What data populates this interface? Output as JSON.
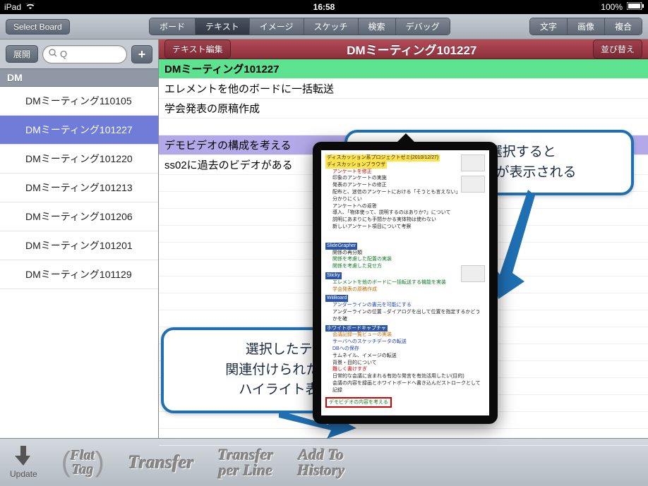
{
  "status": {
    "carrier": "iPad",
    "time": "16:58",
    "battery": "100%"
  },
  "toolbar": {
    "select_board": "Select Board",
    "segments_main": {
      "items": [
        "ボード",
        "テキスト",
        "イメージ",
        "スケッチ",
        "検索",
        "デバッグ"
      ],
      "active_index": 1
    },
    "segments_right": {
      "items": [
        "文字",
        "画像",
        "複合"
      ]
    }
  },
  "sidebar": {
    "expand": "展開",
    "search_placeholder": "Q",
    "group": "DM",
    "items": [
      "DMミーティング110105",
      "DMミーティング101227",
      "DMミーティング101220",
      "DMミーティング101213",
      "DMミーティング101206",
      "DMミーティング101201",
      "DMミーティング101129"
    ],
    "selected_index": 1
  },
  "content": {
    "edit_btn": "テキスト編集",
    "title": "DMミーティング101227",
    "sort_btn": "並び替え",
    "rows": [
      {
        "text": "DMミーティング101227",
        "style": "green"
      },
      {
        "text": "エレメントを他のボードに一括転送",
        "style": ""
      },
      {
        "text": "学会発表の原稿作成",
        "style": ""
      },
      {
        "text": "",
        "style": ""
      },
      {
        "text": "デモビデオの構成を考える",
        "style": "purple"
      },
      {
        "text": "ss02に過去のビデオがある",
        "style": ""
      }
    ]
  },
  "callouts": {
    "c1_l1": "テキストを選択すると",
    "c1_l2": "関連コンテンツが表示される",
    "c2_l1": "選択したテキストに",
    "c2_l2": "関連付けられたテキストが",
    "c2_l3": "ハイライト表示される"
  },
  "doc": {
    "hdr1": "ディスカッション系プロジェクトゼミ(2010/12/27)",
    "hdr2": "ディスカッションブラウザ",
    "red1": "アンケートを修正",
    "b_sg": "SlideGrapher",
    "sg1": "関係の再分類",
    "sg2": "関係を考慮した配置の実装",
    "sg3": "関係を考慮した見せ方",
    "b_st": "Sticky",
    "st1": "エレメントを他のボードに一括転送する機能を実装",
    "st2": "学会発表の原稿作成",
    "b_wb": "WiiBoard",
    "wb1": "アンダーラインの書元を可能にする",
    "b_wc": "ホワイトボードキャプチャ",
    "wc1": "会議記録一覧ビューの実装",
    "wc2": "サーバへのスケッチデータの転送",
    "wc3": "DBへの保存",
    "wc4": "サムネイル、イメージの転送",
    "wc5": "背景・目的について",
    "wc6": "難しく書けすぎ",
    "wc7": "会議の内容を録画とホワイトボードへ書き込んだストロークとして記録",
    "boxed": "デモビデオの内容を考える"
  },
  "bottom": {
    "update": "Update",
    "flat": "Flat",
    "tag": "Tag",
    "transfer": "Transfer",
    "transfer_per_line_1": "Transfer",
    "transfer_per_line_2": "per Line",
    "add_to_1": "Add To",
    "add_to_2": "History"
  }
}
